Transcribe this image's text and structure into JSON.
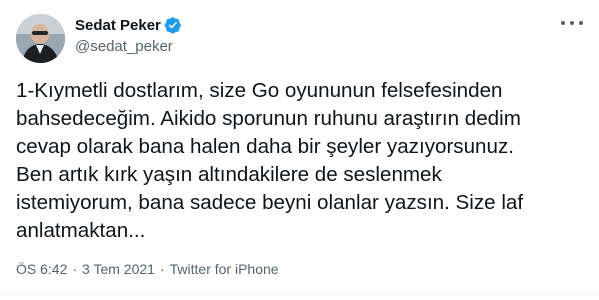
{
  "tweet": {
    "display_name": "Sedat Peker",
    "handle": "@sedat_peker",
    "verified": true,
    "text": "1-Kıymetli dostlarım, size Go oyununun felsefesinden\nbahsedeceğim. Aikido sporunun ruhunu araştırın dedim\ncevap olarak bana halen daha bir şeyler yazıyorsunuz.\nBen artık kırk yaşın altındakilere de seslenmek\nistemiyorum, bana sadece beyni olanlar yazsın. Size laf\nanlatmaktan...",
    "time": "ÖS 6:42",
    "separator": "·",
    "date": "3 Tem 2021",
    "source": "Twitter for iPhone"
  },
  "colors": {
    "verified": "#1d9bf0",
    "secondary_text": "#536471",
    "primary_text": "#0f1419"
  },
  "icons": {
    "verified": "verified-badge-icon",
    "more": "more-options-icon"
  }
}
